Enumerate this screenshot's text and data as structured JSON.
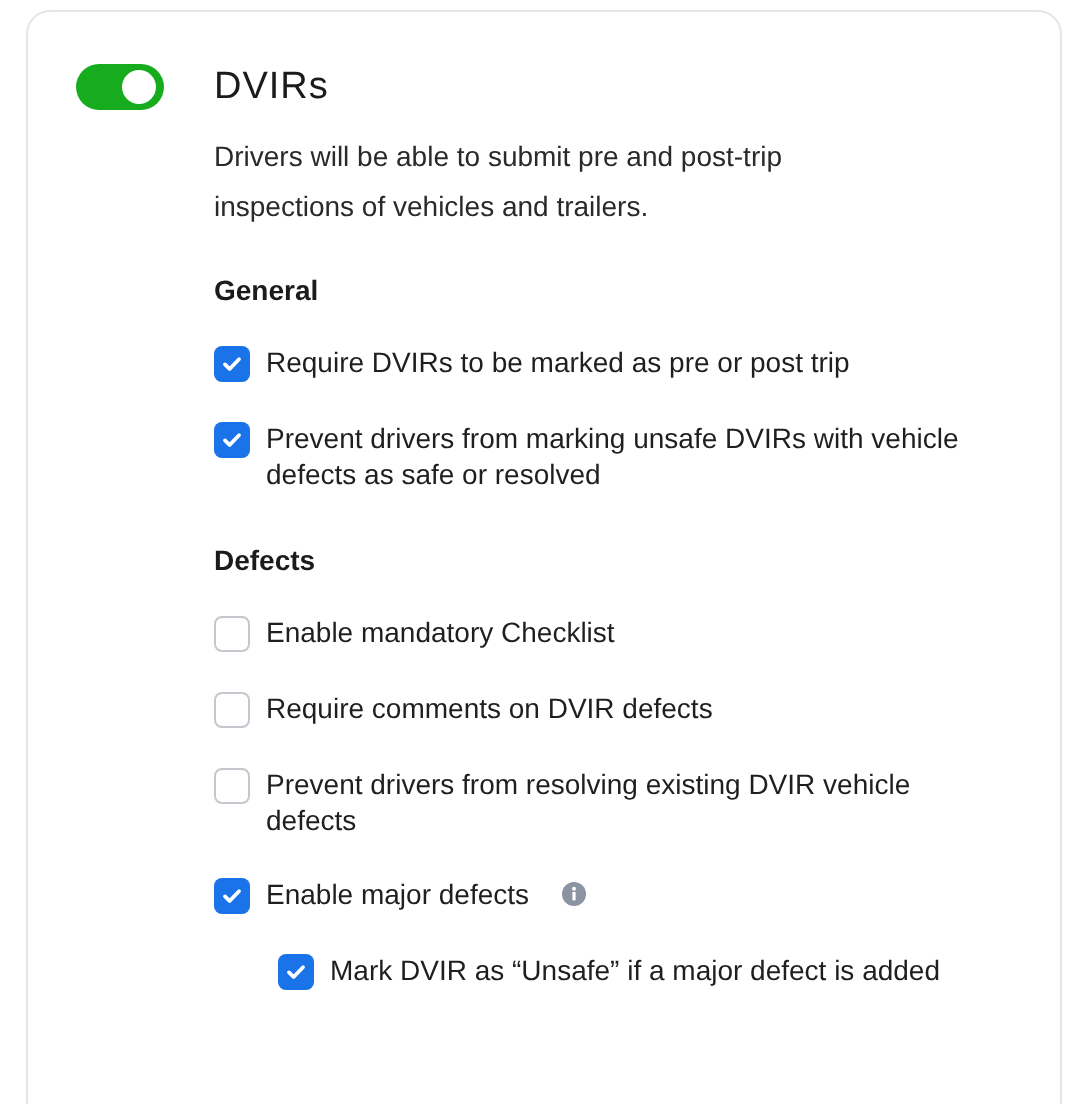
{
  "setting": {
    "title": "DVIRs",
    "enabled": true,
    "description": "Drivers will be able to submit pre and post-trip inspections of vehicles and trailers."
  },
  "sections": [
    {
      "heading": "General",
      "items": [
        {
          "label": "Require DVIRs to be marked as pre or post trip",
          "checked": true
        },
        {
          "label": "Prevent drivers from marking unsafe DVIRs with vehicle defects as safe or resolved",
          "checked": true
        }
      ]
    },
    {
      "heading": "Defects",
      "items": [
        {
          "label": "Enable mandatory Checklist",
          "checked": false
        },
        {
          "label": "Require comments on DVIR defects",
          "checked": false
        },
        {
          "label": "Prevent drivers from resolving existing DVIR vehicle defects",
          "checked": false
        },
        {
          "label": "Enable major defects",
          "checked": true,
          "info": true,
          "children": [
            {
              "label": "Mark DVIR as “Unsafe” if a major defect is added",
              "checked": true
            }
          ]
        }
      ]
    }
  ]
}
